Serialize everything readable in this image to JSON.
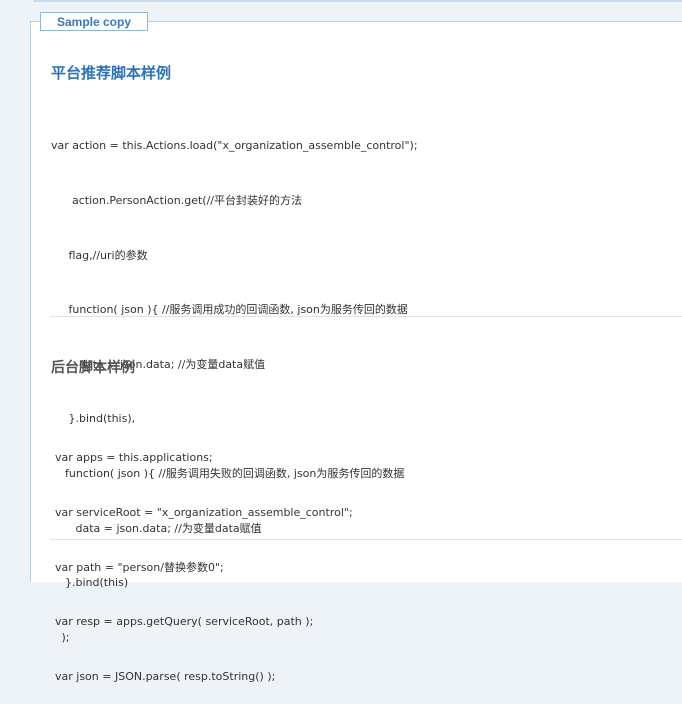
{
  "tab": {
    "label": "Sample copy"
  },
  "front": {
    "title": "平台推荐脚本样例",
    "lines": [
      "var action = this.Actions.load(\"x_organization_assemble_control\");",
      "      action.PersonAction.get(//平台封装好的方法",
      "     flag,//uri的参数",
      "     function( json ){ //服务调用成功的回调函数, json为服务传回的数据",
      "        data = json.data; //为变量data赋值",
      "     }.bind(this),",
      "    function( json ){ //服务调用失败的回调函数, json为服务传回的数据",
      "       data = json.data; //为变量data赋值",
      "    }.bind(this)",
      "   );"
    ]
  },
  "back": {
    "title": "后台脚本样例",
    "lines": [
      "var apps = this.applications;",
      "var serviceRoot = \"x_organization_assemble_control\";",
      "var path = \"person/替换参数0\";",
      "var resp = apps.getQuery( serviceRoot, path );",
      "var json = JSON.parse( resp.toString() );"
    ]
  }
}
